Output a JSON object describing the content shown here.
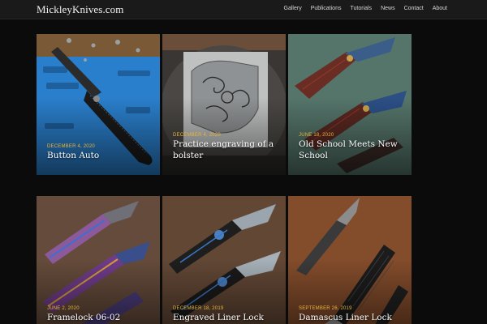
{
  "site": {
    "brand": "MickleyKnives.com"
  },
  "nav": {
    "items": [
      {
        "label": "Gallery"
      },
      {
        "label": "Publications"
      },
      {
        "label": "Tutorials"
      },
      {
        "label": "News"
      },
      {
        "label": "Contact"
      },
      {
        "label": "About"
      }
    ]
  },
  "posts": [
    {
      "date": "DECEMBER 4, 2020",
      "title": "Button Auto"
    },
    {
      "date": "DECEMBER 4, 2020",
      "title": "Practice engraving of a bolster"
    },
    {
      "date": "JUNE 18, 2020",
      "title": "Old School Meets New School"
    },
    {
      "date": "JUNE 2, 2020",
      "title": "Framelock 06-02"
    },
    {
      "date": "DECEMBER 18, 2019",
      "title": "Engraved Liner Lock"
    },
    {
      "date": "SEPTEMBER 26, 2019",
      "title": "Damascus Liner Lock"
    }
  ],
  "colors": {
    "date_accent": "#e8b53a",
    "background": "#0b0b0b",
    "header": "#1a1a1a"
  }
}
